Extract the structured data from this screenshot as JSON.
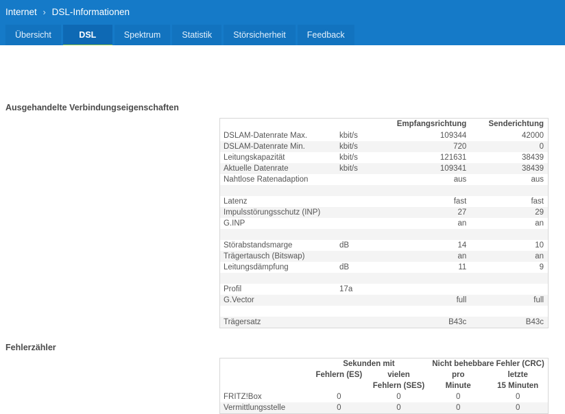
{
  "breadcrumb": {
    "parent": "Internet",
    "separator": "›",
    "current": "DSL-Informationen"
  },
  "tabs": [
    {
      "label": "Übersicht",
      "active": false
    },
    {
      "label": "DSL",
      "active": true
    },
    {
      "label": "Spektrum",
      "active": false
    },
    {
      "label": "Statistik",
      "active": false
    },
    {
      "label": "Störsicherheit",
      "active": false
    },
    {
      "label": "Feedback",
      "active": false
    }
  ],
  "colors": {
    "header_blue": "#157ac8",
    "tab_blue": "#1273bf",
    "tab_active_blue": "#0e69b4",
    "accent_green": "#8cc63e",
    "row_stripe": "#f4f4f4",
    "border": "#d7d7d7"
  },
  "sections": {
    "negotiated_title": "Ausgehandelte Verbindungseigenschaften",
    "errors_title": "Fehlerzähler"
  },
  "negotiated_table": {
    "headers": {
      "label": "",
      "unit": "",
      "downstream": "Empfangsrichtung",
      "upstream": "Senderichtung"
    },
    "rows": [
      {
        "label": "DSLAM-Datenrate Max.",
        "unit": "kbit/s",
        "down": "109344",
        "up": "42000"
      },
      {
        "label": "DSLAM-Datenrate Min.",
        "unit": "kbit/s",
        "down": "720",
        "up": "0"
      },
      {
        "label": "Leitungskapazität",
        "unit": "kbit/s",
        "down": "121631",
        "up": "38439"
      },
      {
        "label": "Aktuelle Datenrate",
        "unit": "kbit/s",
        "down": "109341",
        "up": "38439"
      },
      {
        "label": "Nahtlose Ratenadaption",
        "unit": "",
        "down": "aus",
        "up": "aus"
      },
      {
        "spacer": true
      },
      {
        "label": "Latenz",
        "unit": "",
        "down": "fast",
        "up": "fast"
      },
      {
        "label": "Impulsstörungsschutz (INP)",
        "unit": "",
        "down": "27",
        "up": "29"
      },
      {
        "label": "G.INP",
        "unit": "",
        "down": "an",
        "up": "an"
      },
      {
        "spacer": true
      },
      {
        "label": "Störabstandsmarge",
        "unit": "dB",
        "down": "14",
        "up": "10"
      },
      {
        "label": "Trägertausch (Bitswap)",
        "unit": "",
        "down": "an",
        "up": "an"
      },
      {
        "label": "Leitungsdämpfung",
        "unit": "dB",
        "down": "11",
        "up": "9"
      },
      {
        "spacer": true
      },
      {
        "label": "Profil",
        "unit": "17a",
        "down": "",
        "up": ""
      },
      {
        "label": "G.Vector",
        "unit": "",
        "down": "full",
        "up": "full"
      },
      {
        "spacer": true
      },
      {
        "label": "Trägersatz",
        "unit": "",
        "down": "B43c",
        "up": "B43c"
      }
    ]
  },
  "errors_table": {
    "group_headers": {
      "seconds_with": "Sekunden mit",
      "crc": "Nicht behebbare Fehler (CRC)"
    },
    "column_headers": [
      {
        "line1": "Fehlern (ES)",
        "line2": ""
      },
      {
        "line1": "vielen",
        "line2": "Fehlern (SES)"
      },
      {
        "line1": "pro",
        "line2": "Minute"
      },
      {
        "line1": "letzte",
        "line2": "15 Minuten"
      }
    ],
    "rows": [
      {
        "label": "FRITZ!Box",
        "values": [
          "0",
          "0",
          "0",
          "0"
        ]
      },
      {
        "label": "Vermittlungsstelle",
        "values": [
          "0",
          "0",
          "0",
          "0"
        ]
      }
    ]
  }
}
